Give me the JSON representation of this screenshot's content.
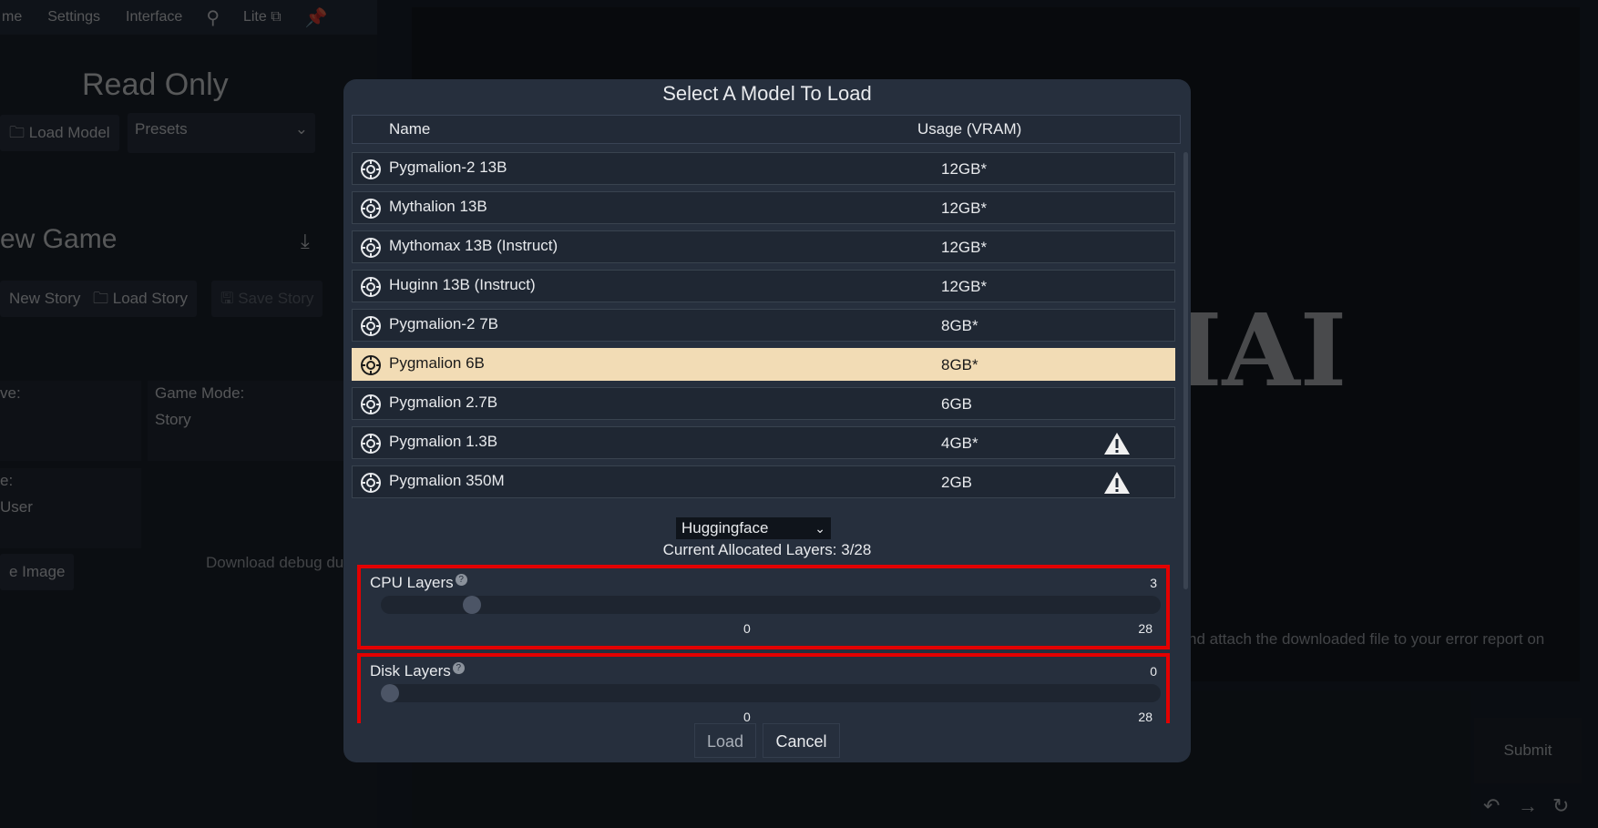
{
  "background": {
    "topbar": {
      "tabs": [
        "me",
        "Settings",
        "Interface"
      ],
      "lite_label": "Lite"
    },
    "read_only_title": "Read Only",
    "load_model_label": "Load Model",
    "presets_label": "Presets",
    "section_title": "ew Game",
    "new_story_label": "New Story",
    "load_story_label": "Load Story",
    "save_story_label": "Save Story",
    "ve_label": "ve:",
    "game_mode_label": "Game Mode:",
    "game_mode_value": "Story",
    "e_label": "e:",
    "user_value": "User",
    "image_label": "e Image",
    "debug_text": "Download debug dur",
    "logo_text": "IAI",
    "right_text": "nd attach the downloaded file to your error report on",
    "submit_label": "Submit"
  },
  "modal": {
    "title": "Select A Model To Load",
    "header": {
      "name": "Name",
      "usage": "Usage (VRAM)"
    },
    "models": [
      {
        "name": "Pygmalion-2 13B",
        "vram": "12GB*",
        "warning": false,
        "selected": false
      },
      {
        "name": "Mythalion 13B",
        "vram": "12GB*",
        "warning": false,
        "selected": false
      },
      {
        "name": "Mythomax 13B (Instruct)",
        "vram": "12GB*",
        "warning": false,
        "selected": false
      },
      {
        "name": "Huginn 13B (Instruct)",
        "vram": "12GB*",
        "warning": false,
        "selected": false
      },
      {
        "name": "Pygmalion-2 7B",
        "vram": "8GB*",
        "warning": false,
        "selected": false
      },
      {
        "name": "Pygmalion 6B",
        "vram": "8GB*",
        "warning": false,
        "selected": true
      },
      {
        "name": "Pygmalion 2.7B",
        "vram": "6GB",
        "warning": false,
        "selected": false
      },
      {
        "name": "Pygmalion 1.3B",
        "vram": "4GB*",
        "warning": true,
        "selected": false
      },
      {
        "name": "Pygmalion 350M",
        "vram": "2GB",
        "warning": true,
        "selected": false
      }
    ],
    "backend_value": "Huggingface",
    "allocated_layers": "Current Allocated Layers: 3/28",
    "cpu_layers": {
      "label": "CPU Layers",
      "value": "3",
      "min": "0",
      "max": "28",
      "level": 3
    },
    "disk_layers": {
      "label": "Disk Layers",
      "value": "0",
      "min": "0",
      "max": "28",
      "level": 0
    },
    "load_label": "Load",
    "cancel_label": "Cancel"
  }
}
